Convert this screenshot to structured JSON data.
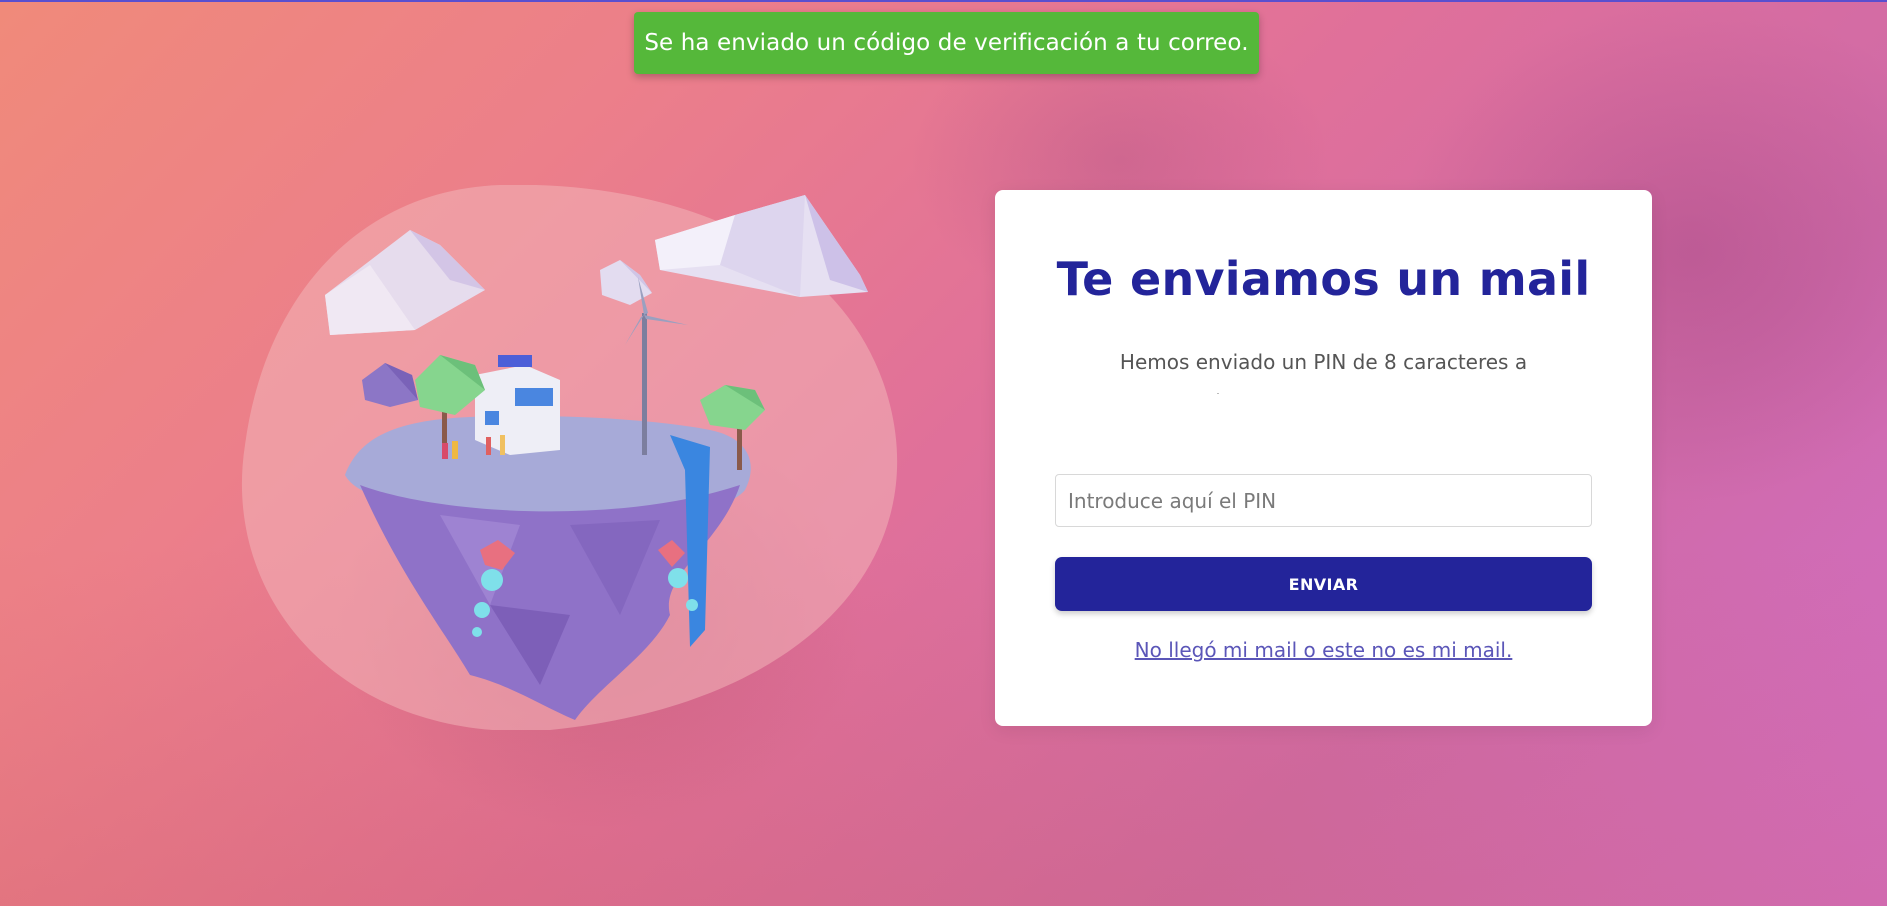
{
  "toast": {
    "message": "Se ha enviado un código de verificación a tu correo.",
    "color": "#55b83a"
  },
  "illustration": {
    "icon": "floating-island-illustration"
  },
  "card": {
    "title": "Te enviamos un mail",
    "subtitle": "Hemos enviado un PIN de 8 caracteres a",
    "pin_input": {
      "value": "",
      "placeholder": "Introduce aquí el PIN"
    },
    "submit_label": "ENVIAR",
    "resend_link": "No llegó mi mail o este no es mi mail."
  },
  "colors": {
    "accent": "#23249a",
    "link": "#5b56b8",
    "success": "#55b83a"
  }
}
